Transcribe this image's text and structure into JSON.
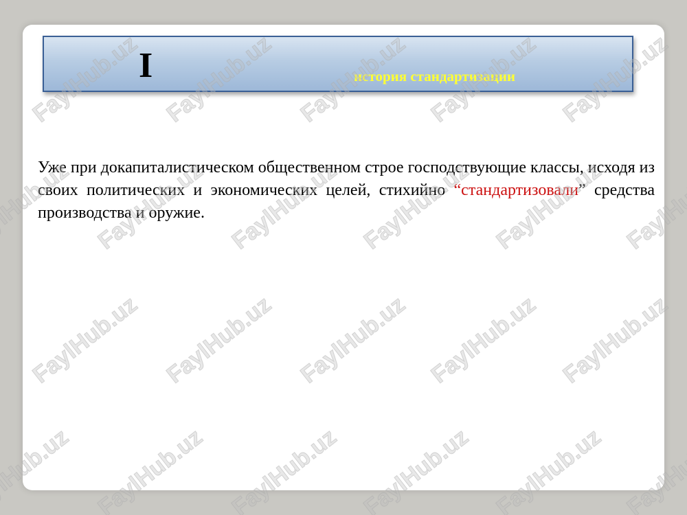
{
  "slide": {
    "roman_numeral": "I",
    "subtitle": "история стандартизации",
    "paragraph": {
      "before": "Уже при докапиталистическом общественном строе господствующие классы, исходя из своих политических и экономических целей, стихийно ",
      "open_quote": "“",
      "highlight": "стандартизовали",
      "close_quote": "”",
      "after": " средства производства и оружие."
    }
  },
  "watermark": {
    "text": "FaylHub.uz"
  },
  "colors": {
    "subtitle": "#ffff33",
    "highlight": "#cc1111",
    "title_border": "#3a5f95"
  }
}
